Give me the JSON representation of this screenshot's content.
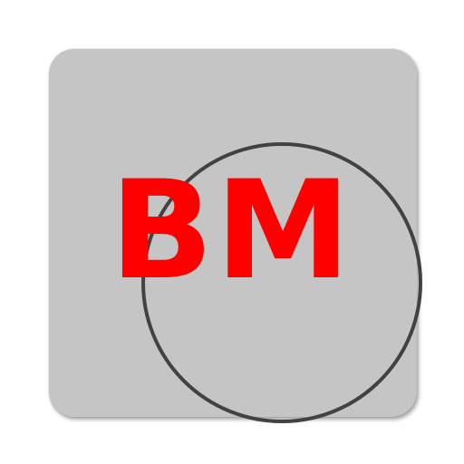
{
  "icon": {
    "monogram": "BM",
    "colors": {
      "background": "#c5c5c5",
      "ring": "#424242",
      "monogram": "#ff0000"
    }
  }
}
